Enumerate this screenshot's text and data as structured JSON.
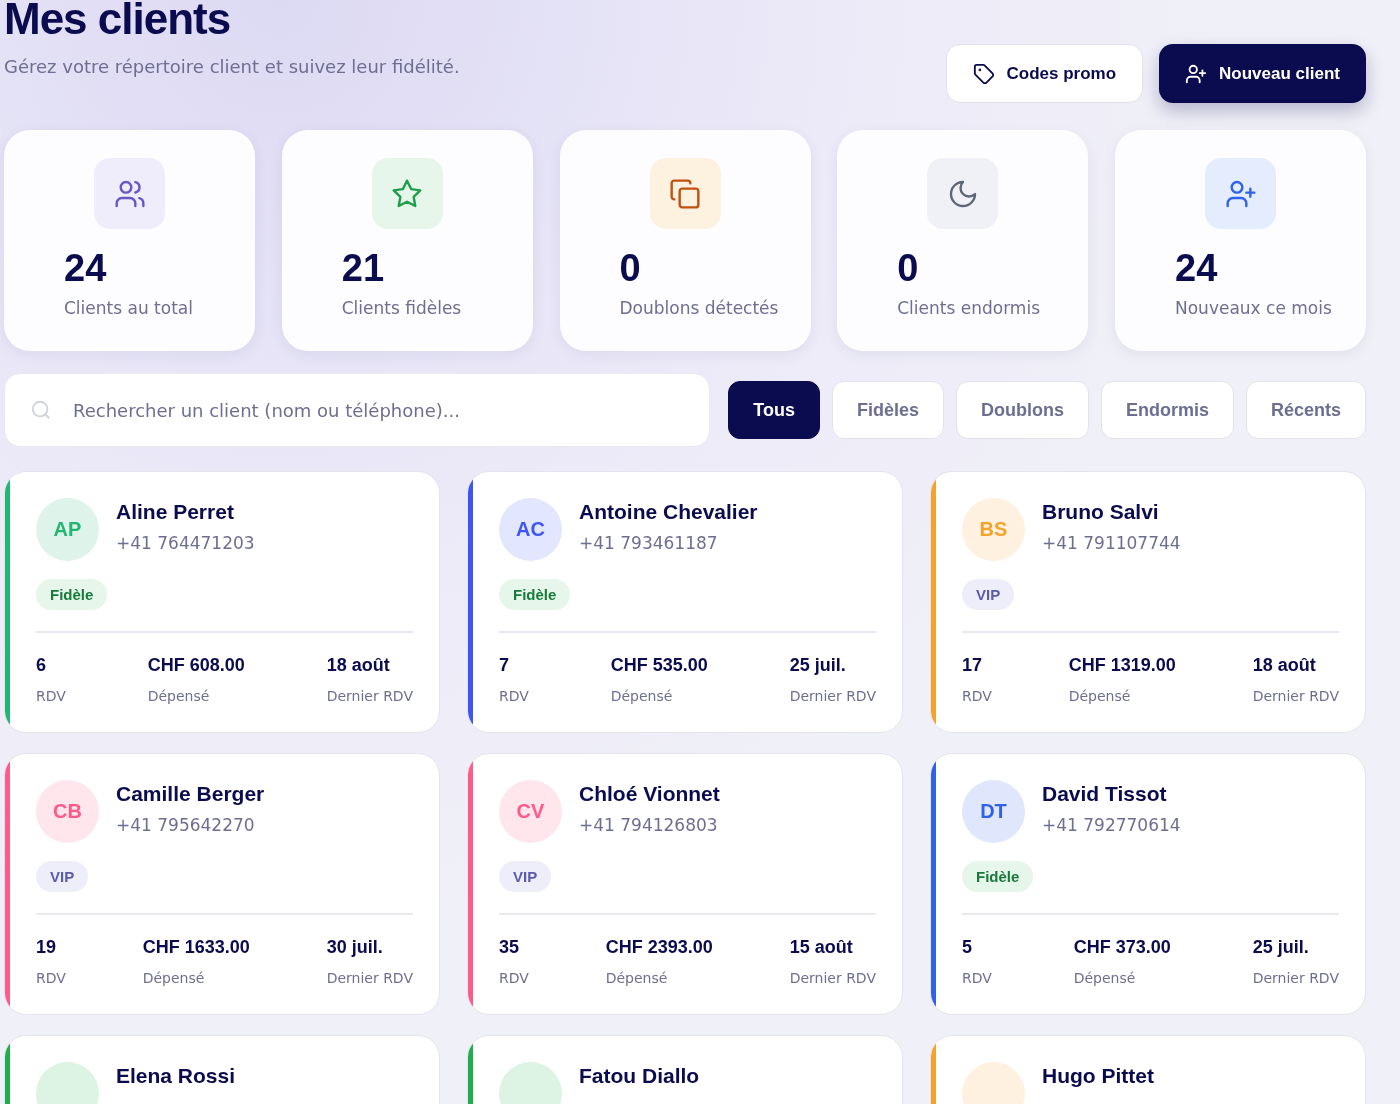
{
  "header": {
    "title": "Mes clients",
    "subtitle": "Gérez votre répertoire client et suivez leur fidélité.",
    "buttons": [
      {
        "label": "Codes promo",
        "kind": "secondary"
      },
      {
        "label": "Nouveau client",
        "kind": "primary"
      }
    ]
  },
  "stats": [
    {
      "kind": "users",
      "value": "24",
      "label": "Clients au total"
    },
    {
      "kind": "star",
      "value": "21",
      "label": "Clients fidèles"
    },
    {
      "kind": "copy",
      "value": "0",
      "label": "Doublons détectés"
    },
    {
      "kind": "moon",
      "value": "0",
      "label": "Clients endormis"
    },
    {
      "kind": "user-plus",
      "value": "24",
      "label": "Nouveaux ce mois"
    }
  ],
  "search": {
    "placeholder": "Rechercher un client (nom ou téléphone)..."
  },
  "filters": [
    {
      "label": "Tous",
      "selected": true
    },
    {
      "label": "Fidèles",
      "selected": false
    },
    {
      "label": "Doublons",
      "selected": false
    },
    {
      "label": "Endormis",
      "selected": false
    },
    {
      "label": "Récents",
      "selected": false
    }
  ],
  "clients": [
    {
      "initials": "AP",
      "name": "Aline Perret",
      "phone": "+41 764471203",
      "color": "#22b573",
      "tag": {
        "label": "Fidèle",
        "kind": "loyal"
      },
      "stats": [
        {
          "value": "6",
          "label": "RDV"
        },
        {
          "value": "CHF 608.00",
          "label": "Dépensé"
        },
        {
          "value": "18 août",
          "label": "Dernier RDV"
        }
      ]
    },
    {
      "initials": "AC",
      "name": "Antoine Chevalier",
      "phone": "+41 793461187",
      "color": "#3d55f5",
      "tag": {
        "label": "Fidèle",
        "kind": "loyal"
      },
      "stats": [
        {
          "value": "7",
          "label": "RDV"
        },
        {
          "value": "CHF 535.00",
          "label": "Dépensé"
        },
        {
          "value": "25 juil.",
          "label": "Dernier RDV"
        }
      ]
    },
    {
      "initials": "BS",
      "name": "Bruno Salvi",
      "phone": "+41 791107744",
      "color": "#f5a22d",
      "tag": {
        "label": "VIP",
        "kind": "vip"
      },
      "stats": [
        {
          "value": "17",
          "label": "RDV"
        },
        {
          "value": "CHF 1319.00",
          "label": "Dépensé"
        },
        {
          "value": "18 août",
          "label": "Dernier RDV"
        }
      ]
    },
    {
      "initials": "CB",
      "name": "Camille Berger",
      "phone": "+41 795642270",
      "color": "#ff5a8a",
      "tag": {
        "label": "VIP",
        "kind": "vip"
      },
      "stats": [
        {
          "value": "19",
          "label": "RDV"
        },
        {
          "value": "CHF 1633.00",
          "label": "Dépensé"
        },
        {
          "value": "30 juil.",
          "label": "Dernier RDV"
        }
      ]
    },
    {
      "initials": "CV",
      "name": "Chloé Vionnet",
      "phone": "+41 794126803",
      "color": "#ff5a8a",
      "tag": {
        "label": "VIP",
        "kind": "vip"
      },
      "stats": [
        {
          "value": "35",
          "label": "RDV"
        },
        {
          "value": "CHF 2393.00",
          "label": "Dépensé"
        },
        {
          "value": "15 août",
          "label": "Dernier RDV"
        }
      ]
    },
    {
      "initials": "DT",
      "name": "David Tissot",
      "phone": "+41 792770614",
      "color": "#2f62e8",
      "tag": {
        "label": "Fidèle",
        "kind": "loyal"
      },
      "stats": [
        {
          "value": "5",
          "label": "RDV"
        },
        {
          "value": "CHF 373.00",
          "label": "Dépensé"
        },
        {
          "value": "25 juil.",
          "label": "Dernier RDV"
        }
      ]
    },
    {
      "name": "Elena Rossi",
      "color": "#1fad4e"
    },
    {
      "name": "Fatou Diallo",
      "color": "#1fad4e"
    },
    {
      "name": "Hugo Pittet",
      "color": "#f5a22d"
    }
  ]
}
